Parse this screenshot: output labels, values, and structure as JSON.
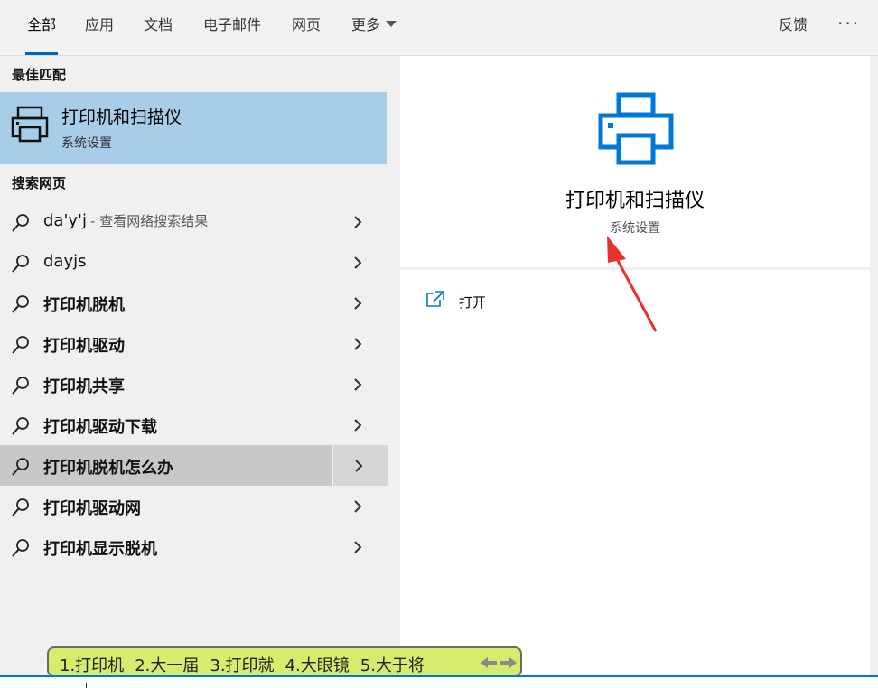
{
  "tabs": [
    {
      "label": "全部",
      "active": true
    },
    {
      "label": "应用"
    },
    {
      "label": "文档"
    },
    {
      "label": "电子邮件"
    },
    {
      "label": "网页"
    },
    {
      "label": "更多"
    }
  ],
  "feedback_label": "反馈",
  "more_options_label": "···",
  "left": {
    "best_match_title": "最佳匹配",
    "best_match": {
      "title": "打印机和扫描仪",
      "subtitle": "系统设置",
      "icon": "printer-icon"
    },
    "web_title": "搜索网页",
    "web_results": [
      {
        "label": "da'y'j",
        "hint": "- 查看网络搜索结果"
      },
      {
        "label": "dayjs"
      },
      {
        "label": "打印机脱机"
      },
      {
        "label": "打印机驱动"
      },
      {
        "label": "打印机共享"
      },
      {
        "label": "打印机驱动下载"
      },
      {
        "label": "打印机脱机怎么办"
      },
      {
        "label": "打印机驱动网"
      },
      {
        "label": "打印机显示脱机"
      }
    ]
  },
  "preview": {
    "title": "打印机和扫描仪",
    "subtitle": "系统设置",
    "open_label": "打开"
  },
  "ime": {
    "candidates": [
      "1.打印机",
      "2.大一届",
      "3.打印就",
      "4.大眼镜",
      "5.大于将"
    ]
  },
  "colors": {
    "accent": "#0067c0",
    "selected": "#a8cde9",
    "annotation_arrow": "#e8302c",
    "ime_bg": "#d7ec6c"
  }
}
